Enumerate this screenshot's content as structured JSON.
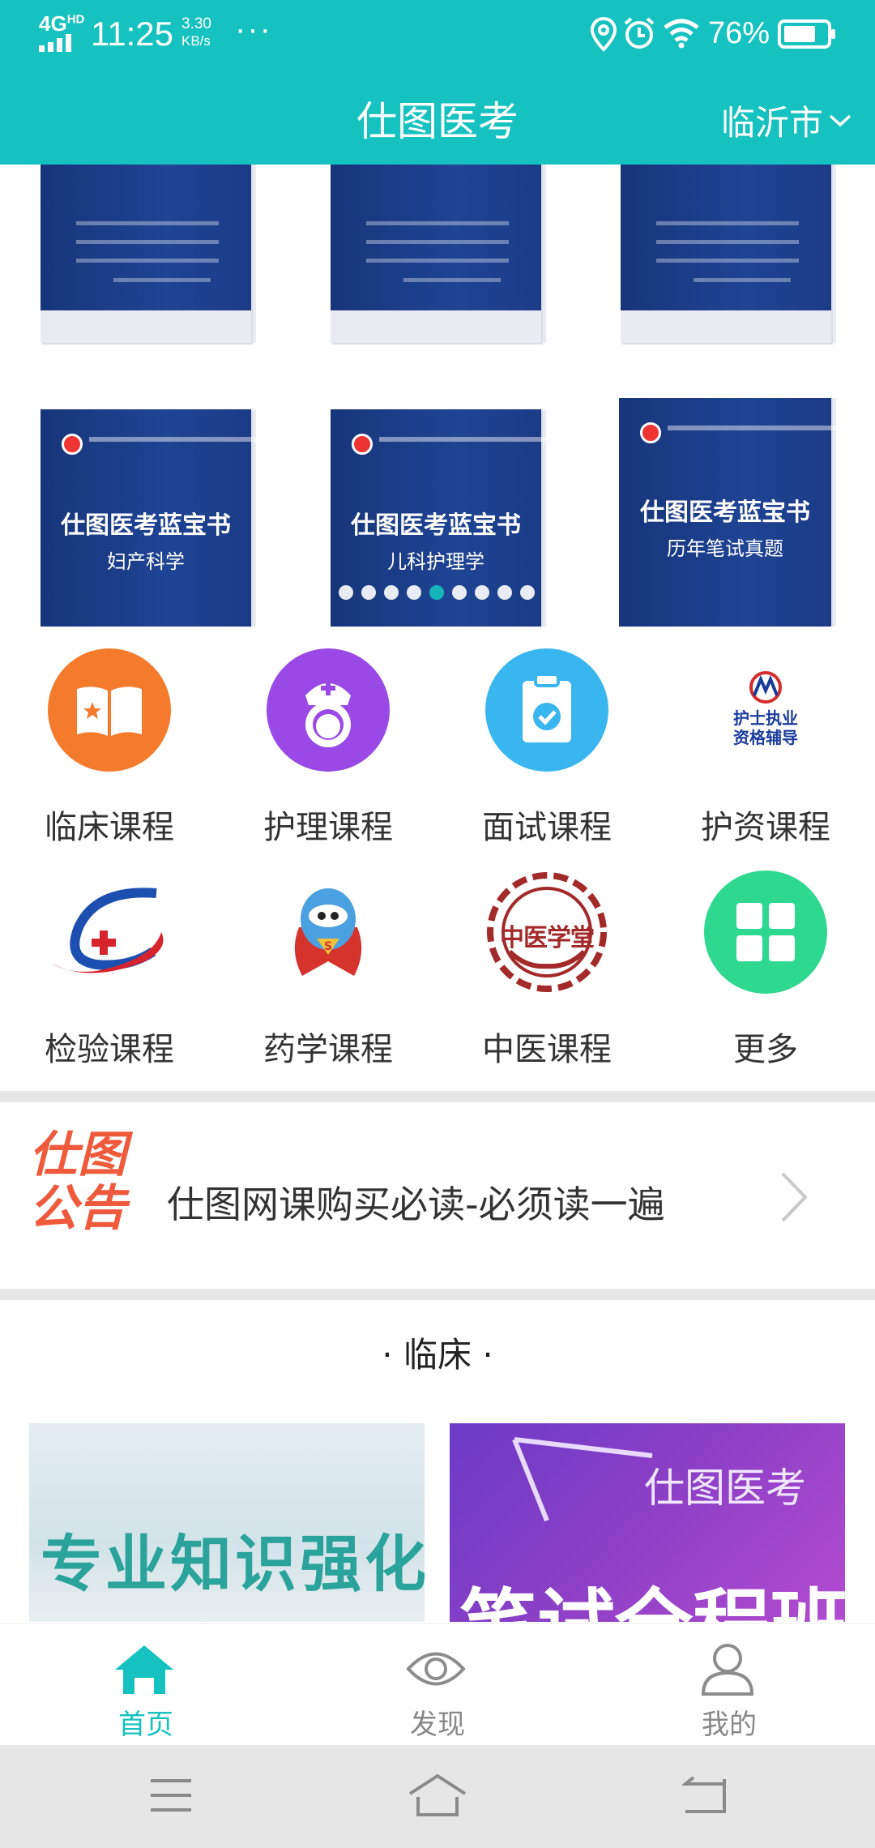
{
  "status_bar": {
    "network": "4G",
    "network_sup": "HD",
    "time": "11:25",
    "rate_value": "3.30",
    "rate_unit": "KB/s",
    "more": "···",
    "battery": "76%"
  },
  "header": {
    "title": "仕图医考",
    "city": "临沂市"
  },
  "banner": {
    "books": [
      {
        "title": "仕图医考蓝宝书",
        "subtitle": "妇产科学"
      },
      {
        "title": "仕图医考蓝宝书",
        "subtitle": "儿科护理学"
      },
      {
        "title": "仕图医考蓝宝书",
        "subtitle": "历年笔试真题"
      }
    ],
    "slide_count": 9,
    "active_slide": 5
  },
  "categories": [
    {
      "label": "临床课程",
      "icon": "open-book-icon"
    },
    {
      "label": "护理课程",
      "icon": "nurse-icon"
    },
    {
      "label": "面试课程",
      "icon": "clipboard-check-icon"
    },
    {
      "label": "护资课程",
      "icon": "nurse-qualification-logo",
      "logo_line1": "护士执业",
      "logo_line2": "资格辅导"
    },
    {
      "label": "检验课程",
      "icon": "lab-logo-icon"
    },
    {
      "label": "药学课程",
      "icon": "mascot-icon"
    },
    {
      "label": "中医课程",
      "icon": "tcm-logo-icon",
      "logo_text": "中医学堂"
    },
    {
      "label": "更多",
      "icon": "grid-icon"
    }
  ],
  "notice": {
    "logo_line1": "仕图",
    "logo_line2": "公告",
    "text": "仕图网课购买必读-必须读一遍"
  },
  "section": {
    "title": "· 临床 ·",
    "courses": [
      {
        "text": "专业知识强化"
      },
      {
        "brand": "仕图医考",
        "text": "笔试全程班"
      }
    ]
  },
  "tabbar": {
    "items": [
      {
        "label": "首页",
        "icon": "home-icon",
        "active": true
      },
      {
        "label": "发现",
        "icon": "eye-icon",
        "active": false
      },
      {
        "label": "我的",
        "icon": "user-icon",
        "active": false
      }
    ]
  },
  "colors": {
    "primary": "#15c2c0",
    "book_blue": "#1f4494",
    "notice_red": "#ef5a3c"
  }
}
